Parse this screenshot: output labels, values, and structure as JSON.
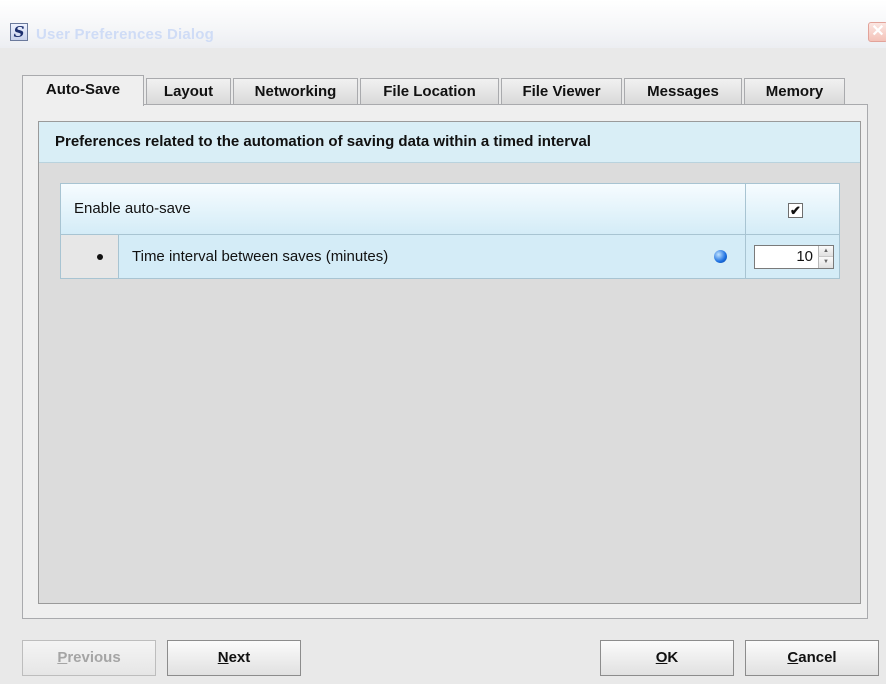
{
  "window": {
    "title": "User Preferences Dialog",
    "app_icon_letter": "S",
    "close_glyph": "✕"
  },
  "tabs": [
    {
      "label": "Auto-Save",
      "active": true
    },
    {
      "label": "Layout",
      "active": false
    },
    {
      "label": "Networking",
      "active": false
    },
    {
      "label": "File Location",
      "active": false
    },
    {
      "label": "File Viewer",
      "active": false
    },
    {
      "label": "Messages",
      "active": false
    },
    {
      "label": "Memory",
      "active": false
    }
  ],
  "panel": {
    "heading": "Preferences related to the automation of saving data within a timed interval",
    "rows": [
      {
        "label": "Enable auto-save",
        "control": "checkbox",
        "checked": true,
        "check_glyph": "✔"
      },
      {
        "label": "Time interval between saves (minutes)",
        "control": "spinner",
        "value": "10",
        "indicator_icon": "blue-dot-icon"
      }
    ]
  },
  "buttons": {
    "previous": {
      "mnemonic": "P",
      "rest": "revious",
      "enabled": false
    },
    "next": {
      "mnemonic": "N",
      "rest": "ext",
      "enabled": true
    },
    "ok": {
      "mnemonic": "O",
      "rest": "K",
      "enabled": true
    },
    "cancel": {
      "mnemonic": "C",
      "rest": "ancel",
      "enabled": true
    }
  },
  "colors": {
    "heading_bg": "#d9eef6",
    "row_bg": "#d4ecf7",
    "indicator": "#1b6fe0"
  }
}
